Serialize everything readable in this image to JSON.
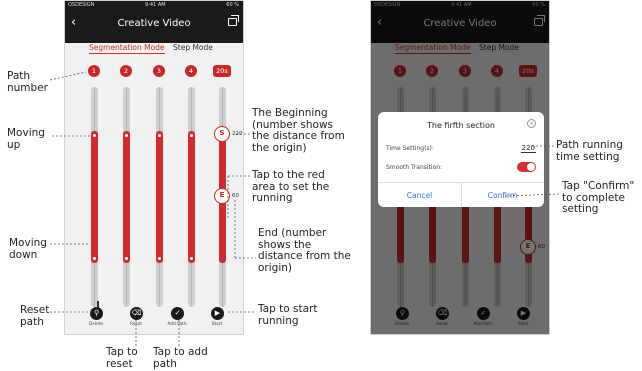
{
  "status_bar": {
    "carrier": "OSDESIGN",
    "time": "9:41 AM",
    "battery": "60 %"
  },
  "nav": {
    "title": "Creative Video"
  },
  "tabs": [
    {
      "label": "Segmentation Mode",
      "active": true
    },
    {
      "label": "Step Mode",
      "active": false
    }
  ],
  "path_numbers": [
    "1",
    "2",
    "3",
    "4",
    "20s"
  ],
  "tracks": [
    {
      "start": 0.8,
      "end": 0.2
    },
    {
      "start": 0.8,
      "end": 0.2
    },
    {
      "start": 0.8,
      "end": 0.2
    },
    {
      "start": 0.8,
      "end": 0.2
    },
    {
      "start": 0.8,
      "end": 0.2
    }
  ],
  "nodes": {
    "start": {
      "label": "S",
      "value": "220"
    },
    "end": {
      "label": "E",
      "value": "60"
    }
  },
  "toolbar": [
    {
      "label": "Delete",
      "icon": "trash-icon"
    },
    {
      "label": "Reset",
      "icon": "eraser-icon"
    },
    {
      "label": "Add Path",
      "icon": "checkmark-icon"
    },
    {
      "label": "Start",
      "icon": "play-icon"
    }
  ],
  "dialog": {
    "title": "The firfth section",
    "time_label": "Time Setting(s):",
    "time_value": "220",
    "smooth_label": "Smooth Transition:",
    "smooth_on": true,
    "cancel": "Cancel",
    "confirm": "Confirm"
  },
  "annotations": {
    "path_number": "Path number",
    "moving_up": "Moving up",
    "moving_down": "Moving down",
    "reset_path": "Reset path",
    "tap_reset": "Tap to reset",
    "tap_add": "Tap to add path",
    "beginning": "The Beginning (number shows the distance from the origin)",
    "tap_red": "Tap to the red area to set the running",
    "end": "End (number shows the distance from the origin)",
    "tap_start": "Tap to start running",
    "path_running": "Path running time setting",
    "tap_confirm": "Tap \"Confirm\" to complete setting"
  },
  "colors": {
    "accent": "#c62828",
    "link": "#3a6fd6",
    "nav_bg": "#1a1a1a"
  }
}
